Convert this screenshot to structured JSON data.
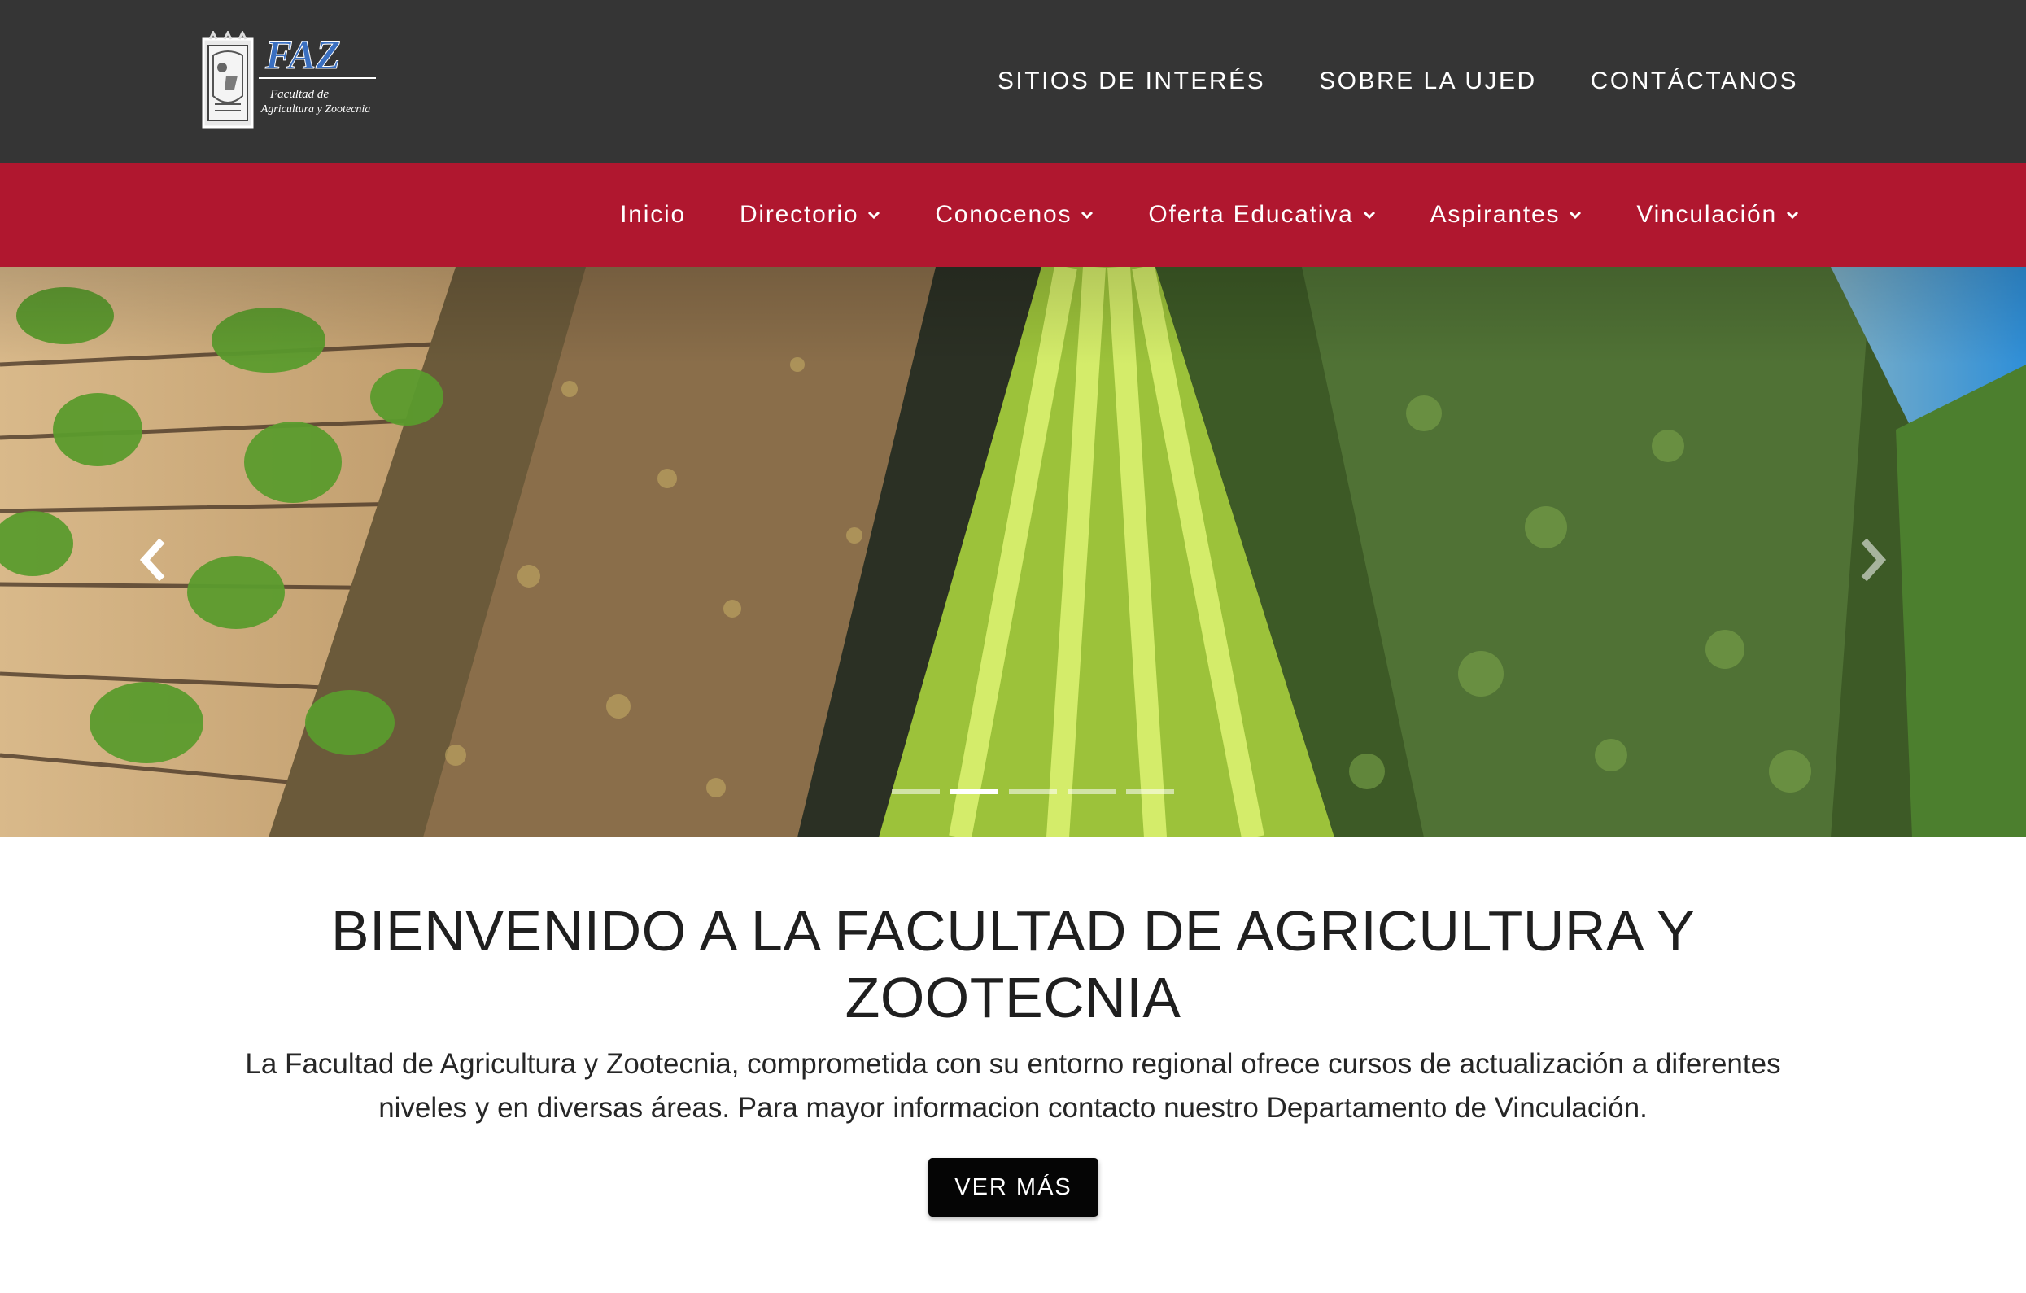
{
  "header": {
    "logo": {
      "text": "FAZ",
      "subtitle_line1": "Facultad de",
      "subtitle_line2": "Agricultura y Zootecnia"
    },
    "top_links": [
      {
        "label": "SITIOS DE INTERÉS"
      },
      {
        "label": "SOBRE LA UJED"
      },
      {
        "label": "CONTÁCTANOS"
      }
    ]
  },
  "nav": {
    "items": [
      {
        "label": "Inicio",
        "has_dropdown": false
      },
      {
        "label": "Directorio",
        "has_dropdown": true
      },
      {
        "label": "Conocenos",
        "has_dropdown": true
      },
      {
        "label": "Oferta Educativa",
        "has_dropdown": true
      },
      {
        "label": "Aspirantes",
        "has_dropdown": true
      },
      {
        "label": "Vinculación",
        "has_dropdown": true
      }
    ]
  },
  "carousel": {
    "slide_count": 5,
    "active_index": 1,
    "prev_icon": "chevron-left-icon",
    "next_icon": "chevron-right-icon"
  },
  "welcome": {
    "title": "BIENVENIDO A LA FACULTAD DE AGRICULTURA Y ZOOTECNIA",
    "text": "La Facultad de Agricultura y Zootecnia, comprometida con su entorno regional ofrece cursos de actualización a diferentes niveles y en diversas áreas. Para mayor informacion contacto nuestro Departamento de Vinculación.",
    "button_label": "VER MÁS"
  },
  "colors": {
    "topbar": "#353535",
    "navbar": "#b0172f",
    "button": "#050505"
  }
}
